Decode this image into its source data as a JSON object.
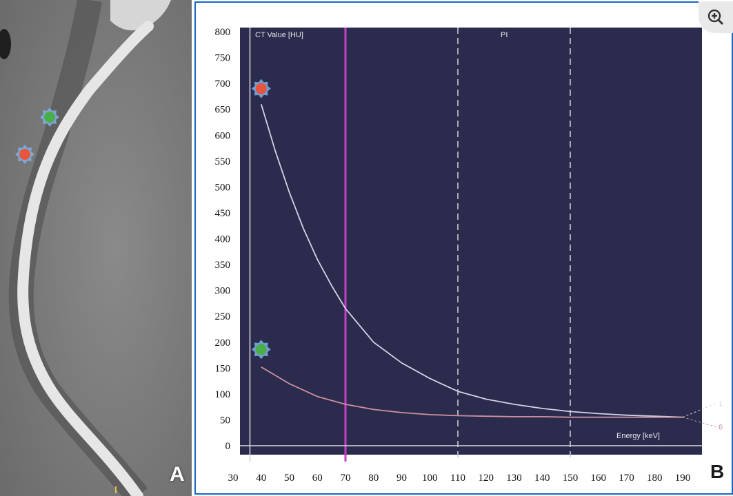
{
  "panels": {
    "a": {
      "label": "A"
    },
    "b": {
      "label": "B"
    }
  },
  "zoom_icon": "zoom-in-icon",
  "colors": {
    "plot_bg": "#2b2c4d",
    "frame": "#1566c9",
    "curve_1": "#d2d2e6",
    "curve_6": "#cf8f9f",
    "marker_red": "#e8553c",
    "marker_green": "#4cae48",
    "marker_halo": "#7fb2e6",
    "magenta_line": "#c83ec8",
    "ct_image_bg": "#7a7a7a",
    "vessel": "#e6e6e6"
  },
  "chart_data": {
    "type": "line",
    "ylabel": "CT Value [HU]",
    "xlabel": "Energy [keV]",
    "pi_label": "PI",
    "xlim": [
      30,
      195
    ],
    "ylim": [
      0,
      800
    ],
    "x_ticks": [
      30,
      40,
      50,
      60,
      70,
      80,
      90,
      100,
      110,
      120,
      130,
      140,
      150,
      160,
      170,
      180,
      190
    ],
    "y_ticks": [
      0,
      50,
      100,
      150,
      200,
      250,
      300,
      350,
      400,
      450,
      500,
      550,
      600,
      650,
      700,
      750,
      800
    ],
    "series": [
      {
        "name": "1",
        "color": "#d2d2e6",
        "x": [
          40,
          45,
          50,
          55,
          60,
          65,
          70,
          80,
          90,
          100,
          110,
          120,
          130,
          140,
          150,
          160,
          170,
          180,
          190
        ],
        "y": [
          660,
          570,
          490,
          420,
          360,
          310,
          265,
          200,
          160,
          130,
          105,
          90,
          80,
          72,
          66,
          62,
          59,
          57,
          55
        ]
      },
      {
        "name": "6",
        "color": "#cf8f9f",
        "x": [
          40,
          50,
          60,
          70,
          80,
          90,
          100,
          110,
          120,
          130,
          140,
          150,
          160,
          170,
          180,
          190
        ],
        "y": [
          152,
          120,
          95,
          80,
          70,
          64,
          60,
          58,
          57,
          56,
          56,
          55,
          55,
          55,
          55,
          55
        ]
      }
    ],
    "markers": [
      {
        "color_key": "marker_red",
        "x": 40,
        "y": 690
      },
      {
        "color_key": "marker_green",
        "x": 40,
        "y": 186
      }
    ],
    "vertical_lines": [
      {
        "x": 36,
        "style": "solid",
        "color": "#d0d0d8"
      },
      {
        "x": 70,
        "style": "solid",
        "color": "#c83ec8"
      },
      {
        "x": 110,
        "style": "dashed",
        "color": "#c8c8d0"
      },
      {
        "x": 150,
        "style": "dashed",
        "color": "#c8c8d0"
      }
    ],
    "grid": false
  },
  "image_markers": [
    {
      "color_key": "marker_green"
    },
    {
      "color_key": "marker_red"
    }
  ]
}
